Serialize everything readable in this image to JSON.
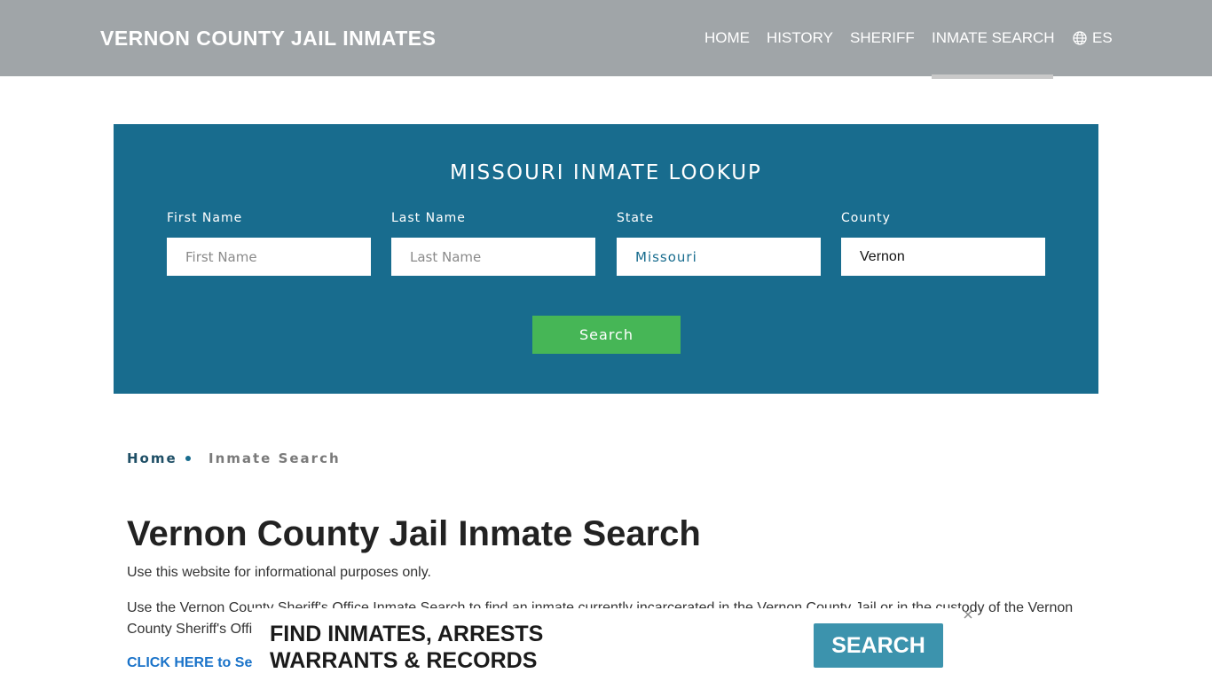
{
  "header": {
    "brand": "VERNON COUNTY JAIL INMATES",
    "nav": {
      "home": "HOME",
      "history": "HISTORY",
      "sheriff": "SHERIFF",
      "inmate_search": "INMATE SEARCH",
      "language": "ES"
    },
    "active_item": "INMATE SEARCH",
    "background_color": "#a0a5a8"
  },
  "lookup": {
    "title": "MISSOURI INMATE LOOKUP",
    "background_color": "#186c8e",
    "fields": {
      "first_name": {
        "label": "First Name",
        "placeholder": "First Name",
        "value": ""
      },
      "last_name": {
        "label": "Last Name",
        "placeholder": "Last Name",
        "value": ""
      },
      "state": {
        "label": "State",
        "value": "Missouri"
      },
      "county": {
        "label": "County",
        "value": "Vernon"
      }
    },
    "search_button": "Search",
    "search_button_color": "#46b656"
  },
  "breadcrumb": {
    "home": "Home",
    "current": "Inmate Search"
  },
  "main": {
    "title": "Vernon County Jail Inmate Search",
    "paragraph_1": "Use this website for informational purposes only.",
    "paragraph_2": "Use the Vernon County Sheriff's Office Inmate Search to find an inmate currently incarcerated in the Vernon County Jail or in the custody of the Vernon County Sheriff's Offi",
    "link": "CLICK HERE to Se"
  },
  "ad": {
    "line_1": "FIND INMATES, ARRESTS",
    "line_2": "WARRANTS & RECORDS",
    "button": "SEARCH",
    "button_color": "#3c93ad"
  },
  "icons": {
    "language": "globe-icon",
    "ad_close": "close-icon"
  }
}
